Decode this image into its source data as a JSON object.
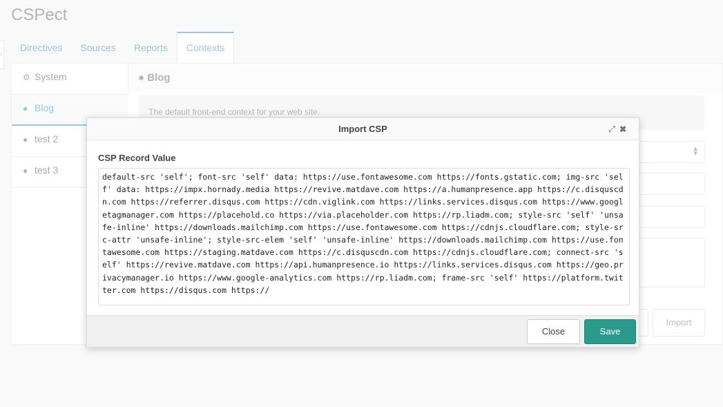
{
  "app": {
    "title": "CSPect"
  },
  "tabs": [
    {
      "label": "Directives"
    },
    {
      "label": "Sources"
    },
    {
      "label": "Reports"
    },
    {
      "label": "Contexts"
    }
  ],
  "contexts": [
    {
      "label": "System",
      "icon": "gear-icon"
    },
    {
      "label": "Blog",
      "icon": "globe-icon"
    },
    {
      "label": "test 2",
      "icon": "globe-icon"
    },
    {
      "label": "test 3",
      "icon": "globe-icon"
    }
  ],
  "detail": {
    "title": "Blog",
    "description": "The default front-end context for your web site.",
    "import_label": "Import"
  },
  "modal": {
    "title": "Import CSP",
    "field_label": "CSP Record Value",
    "close_label": "Close",
    "save_label": "Save",
    "csp_value": "default-src 'self'; font-src 'self' data: https://use.fontawesome.com https://fonts.gstatic.com; img-src 'self' data: https://impx.hornady.media https://revive.matdave.com https://a.humanpresence.app https://c.disquscdn.com https://referrer.disqus.com https://cdn.viglink.com https://links.services.disqus.com https://www.googletagmanager.com https://placehold.co https://via.placeholder.com https://rp.liadm.com; style-src 'self' 'unsafe-inline' https://downloads.mailchimp.com https://use.fontawesome.com https://cdnjs.cloudflare.com; style-src-attr 'unsafe-inline'; style-src-elem 'self' 'unsafe-inline' https://downloads.mailchimp.com https://use.fontawesome.com https://staging.matdave.com https://c.disquscdn.com https://cdnjs.cloudflare.com; connect-src 'self' https://revive.matdave.com https://api.humanpresence.io https://links.services.disqus.com https://geo.privacymanager.io https://www.google-analytics.com https://rp.liadm.com; frame-src 'self' https://platform.twitter.com https://disqus.com https://"
  },
  "colors": {
    "accent": "#5ba4cf",
    "save": "#2a9a8c"
  }
}
